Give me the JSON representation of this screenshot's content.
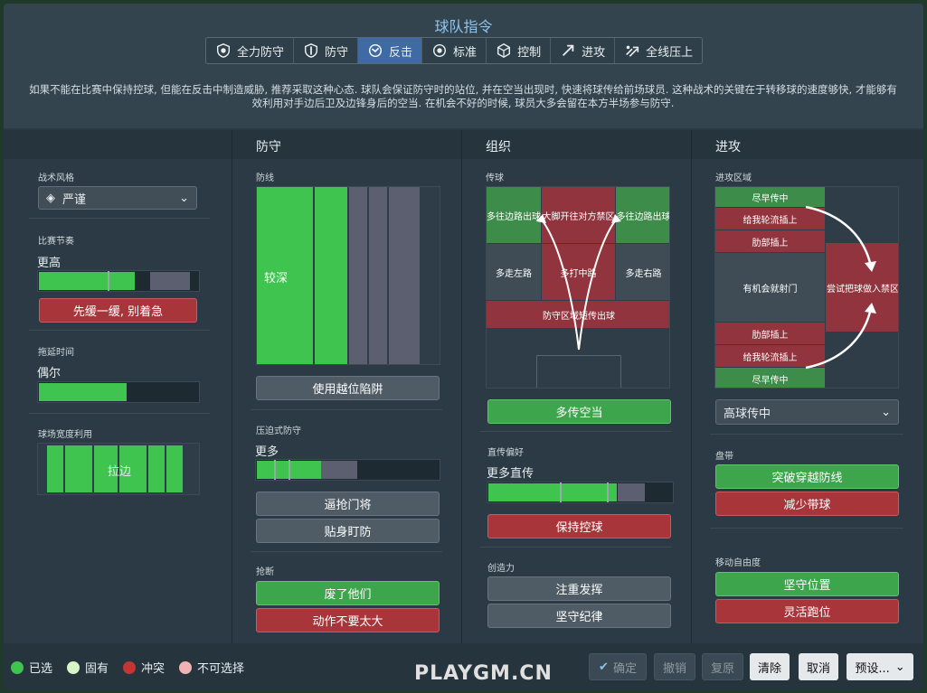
{
  "title": "球队指令",
  "modes": [
    {
      "label": "全力防守",
      "icon": "shield-heart-icon"
    },
    {
      "label": "防守",
      "icon": "shield-icon"
    },
    {
      "label": "反击",
      "icon": "counter-icon",
      "active": true
    },
    {
      "label": "标准",
      "icon": "target-icon"
    },
    {
      "label": "控制",
      "icon": "cube-icon"
    },
    {
      "label": "进攻",
      "icon": "arrow-diagonal-icon"
    },
    {
      "label": "全线压上",
      "icon": "multi-arrow-icon"
    }
  ],
  "description": "如果不能在比赛中保持控球, 但能在反击中制造威胁, 推荐采取这种心态. 球队会保证防守时的站位, 并在空当出现时, 快速将球传给前场球员. 这种战术的关键在于转移球的速度够快, 才能够有效利用对手边后卫及边锋身后的空当. 在机会不好的时候, 球员大多会留在本方半场参与防守.",
  "left": {
    "style_label": "战术风格",
    "style_value": "严谨",
    "tempo_label": "比赛节奏",
    "tempo_value": "更高",
    "tempo_level": 0.6,
    "tempo_button": "先缓一缓, 别着急",
    "timewasting_label": "拖延时间",
    "timewasting_value": "偶尔",
    "timewasting_level": 0.55,
    "width_label": "球场宽度利用",
    "width_value": "拉边"
  },
  "defense": {
    "header": "防守",
    "line_label": "防线",
    "line_value": "较深",
    "offside_button": "使用越位陷阱",
    "press_label": "压迫式防守",
    "press_value": "更多",
    "press_level": 0.55,
    "press_buttons": [
      "逼抢门将",
      "贴身盯防"
    ],
    "tackle_label": "抢断",
    "tackle_buttons": [
      "废了他们",
      "动作不要太大"
    ]
  },
  "organization": {
    "header": "组织",
    "passing_label": "传球",
    "pitch_zones": {
      "left_wing": "多往边路出球",
      "center_top": "大脚开往对方禁区",
      "right_wing": "多往边路出球",
      "left_mid": "多走左路",
      "center_mid": "多打中路",
      "right_mid": "多走右路",
      "defense": "防守区域短传出球"
    },
    "space_button": "多传空当",
    "directness_label": "直传偏好",
    "directness_value": "更多直传",
    "directness_level": 0.7,
    "retain_button": "保持控球",
    "creativity_label": "创造力",
    "creativity_buttons": [
      "注重发挥",
      "坚守纪律"
    ]
  },
  "attack": {
    "header": "进攻",
    "zone_label": "进攻区域",
    "pitch_zones": {
      "early_cross_top": "尽早传中",
      "overlap_top": "给我轮流插上",
      "underlap_top": "肋部插上",
      "shoot_on_sight": "有机会就射门",
      "work_into_box": "尝试把球做入禁区",
      "underlap_bottom": "肋部插上",
      "overlap_bottom": "给我轮流插上",
      "early_cross_bottom": "尽早传中"
    },
    "cross_select": "高球传中",
    "dribble_label": "盘带",
    "dribble_buttons": [
      "突破穿越防线",
      "减少带球"
    ],
    "freedom_label": "移动自由度",
    "freedom_buttons": [
      "坚守位置",
      "灵活跑位"
    ]
  },
  "legend": [
    {
      "label": "已选",
      "color": "#3fc450"
    },
    {
      "label": "固有",
      "color": "#d8f5c8"
    },
    {
      "label": "冲突",
      "color": "#c43535"
    },
    {
      "label": "不可选择",
      "color": "#f0b3b3"
    }
  ],
  "footer_buttons": {
    "confirm": "确定",
    "undo": "撤销",
    "restore": "复原",
    "clear": "清除",
    "cancel": "取消",
    "preset": "预设..."
  },
  "watermark": "PLAYGM.CN"
}
